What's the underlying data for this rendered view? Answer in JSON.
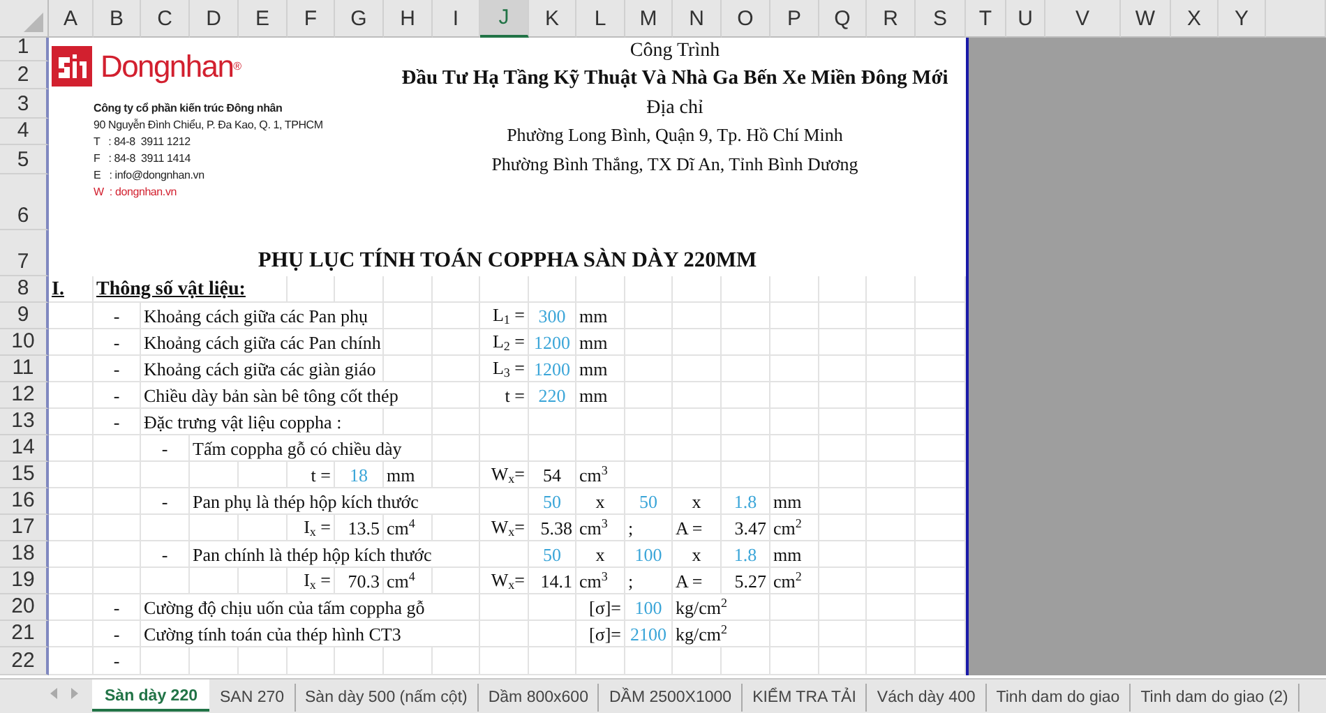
{
  "columns": [
    {
      "label": "A",
      "selected": false
    },
    {
      "label": "B",
      "selected": false
    },
    {
      "label": "C",
      "selected": false
    },
    {
      "label": "D",
      "selected": false
    },
    {
      "label": "E",
      "selected": false
    },
    {
      "label": "F",
      "selected": false
    },
    {
      "label": "G",
      "selected": false
    },
    {
      "label": "H",
      "selected": false
    },
    {
      "label": "I",
      "selected": false
    },
    {
      "label": "J",
      "selected": true
    },
    {
      "label": "K",
      "selected": false
    },
    {
      "label": "L",
      "selected": false
    },
    {
      "label": "M",
      "selected": false
    },
    {
      "label": "N",
      "selected": false
    },
    {
      "label": "O",
      "selected": false
    },
    {
      "label": "P",
      "selected": false
    },
    {
      "label": "Q",
      "selected": false
    },
    {
      "label": "R",
      "selected": false
    },
    {
      "label": "S",
      "selected": false
    },
    {
      "label": "T",
      "selected": false
    },
    {
      "label": "U",
      "selected": false
    },
    {
      "label": "V",
      "selected": false
    },
    {
      "label": "W",
      "selected": false
    },
    {
      "label": "X",
      "selected": false
    },
    {
      "label": "Y",
      "selected": false
    }
  ],
  "logo": {
    "brand": "Dongnhan$^{®}$"
  },
  "company": {
    "lines": [
      {
        "kind": "name",
        "text": "Công ty cổ phần kiến trúc Đông nhân"
      },
      {
        "kind": "plain",
        "text": "90 Nguyễn Đình Chiểu, P. Đa Kao, Q. 1, TPHCM"
      },
      {
        "kind": "plain",
        "text": "T   : 84-8  3911 1212"
      },
      {
        "kind": "plain",
        "text": "F   : 84-8  3911 1414"
      },
      {
        "kind": "plain",
        "text": "E   : info@dongnhan.vn"
      },
      {
        "kind": "web",
        "text": "W  : dongnhan.vn"
      }
    ]
  },
  "rows": [
    {
      "number": "1",
      "cells": [
        {
          "kind": "title",
          "text": "Công Trình"
        }
      ]
    },
    {
      "number": "2",
      "cells": [
        {
          "kind": "title-bold",
          "text": "Đầu Tư Hạ Tầng Kỹ Thuật Và Nhà Ga Bến Xe Miền Đông Mới"
        }
      ]
    },
    {
      "number": "3",
      "cells": [
        {
          "kind": "title",
          "text": "Địa chỉ"
        }
      ]
    },
    {
      "number": "4",
      "cells": [
        {
          "kind": "title-small",
          "text": "Phường Long Bình, Quận 9, Tp. Hồ Chí Minh"
        }
      ]
    },
    {
      "number": "5",
      "cells": [
        {
          "kind": "title-small",
          "text": "Phường Bình Thắng, TX Dĩ An, Tỉnh Bình Dương"
        }
      ]
    },
    {
      "number": "6",
      "cells": []
    },
    {
      "number": "7",
      "cells": [
        {
          "kind": "doc-title",
          "text": "PHỤ LỤC TÍNH TOÁN COPPHA SÀN DÀY 220MM"
        }
      ]
    },
    {
      "number": "8",
      "cells": [
        {
          "kind": "heading",
          "text": "I."
        },
        {
          "kind": "heading",
          "text": "Thông số vật liệu:"
        }
      ]
    },
    {
      "number": "9",
      "cells": [
        {
          "kind": "dash",
          "text": "-"
        },
        {
          "kind": "text",
          "text": "Khoảng cách giữa các Pan phụ"
        },
        {
          "kind": "label",
          "text": "L$_{1}$ ="
        },
        {
          "kind": "input",
          "text": "300"
        },
        {
          "kind": "unit",
          "text": "mm"
        }
      ]
    },
    {
      "number": "10",
      "cells": [
        {
          "kind": "dash",
          "text": "-"
        },
        {
          "kind": "text",
          "text": "Khoảng cách giữa các Pan chính"
        },
        {
          "kind": "label",
          "text": "L$_{2}$ ="
        },
        {
          "kind": "input",
          "text": "1200"
        },
        {
          "kind": "unit",
          "text": "mm"
        }
      ]
    },
    {
      "number": "11",
      "cells": [
        {
          "kind": "dash",
          "text": "-"
        },
        {
          "kind": "text",
          "text": "Khoảng cách giữa các giàn giáo"
        },
        {
          "kind": "label",
          "text": "L$_{3}$ ="
        },
        {
          "kind": "input",
          "text": "1200"
        },
        {
          "kind": "unit",
          "text": "mm"
        }
      ]
    },
    {
      "number": "12",
      "cells": [
        {
          "kind": "dash",
          "text": "-"
        },
        {
          "kind": "text",
          "text": "Chiều dày bản sàn bê tông cốt thép"
        },
        {
          "kind": "label",
          "text": "t ="
        },
        {
          "kind": "input",
          "text": "220"
        },
        {
          "kind": "unit",
          "text": "mm"
        }
      ]
    },
    {
      "number": "13",
      "cells": [
        {
          "kind": "dash",
          "text": "-"
        },
        {
          "kind": "text",
          "text": "Đặc trưng vật liệu coppha :"
        }
      ]
    },
    {
      "number": "14",
      "cells": [
        {
          "kind": "dash",
          "text": "-"
        },
        {
          "kind": "text",
          "text": "Tấm coppha gỗ có chiều dày"
        }
      ]
    },
    {
      "number": "15",
      "cells": [
        {
          "kind": "label",
          "text": "t ="
        },
        {
          "kind": "input",
          "text": "18"
        },
        {
          "kind": "unit",
          "text": "mm"
        },
        {
          "kind": "label",
          "text": "W$_{x}$="
        },
        {
          "kind": "value",
          "text": "54"
        },
        {
          "kind": "unit",
          "text": "cm$^{3}$"
        }
      ]
    },
    {
      "number": "16",
      "cells": [
        {
          "kind": "dash",
          "text": "-"
        },
        {
          "kind": "text",
          "text": "Pan phụ là thép hộp kích thước"
        },
        {
          "kind": "input",
          "text": "50"
        },
        {
          "kind": "dash",
          "text": "x"
        },
        {
          "kind": "input",
          "text": "50"
        },
        {
          "kind": "dash",
          "text": "x"
        },
        {
          "kind": "input",
          "text": "1.8"
        },
        {
          "kind": "unit",
          "text": "mm"
        }
      ]
    },
    {
      "number": "17",
      "cells": [
        {
          "kind": "label",
          "text": "I$_{x}$ ="
        },
        {
          "kind": "number",
          "text": "13.5"
        },
        {
          "kind": "unit",
          "text": "cm$^{4}$"
        },
        {
          "kind": "label",
          "text": "W$_{x}$="
        },
        {
          "kind": "number",
          "text": "5.38"
        },
        {
          "kind": "unit",
          "text": "cm$^{3}$"
        },
        {
          "kind": "unit",
          "text": ";"
        },
        {
          "kind": "unit",
          "text": "A ="
        },
        {
          "kind": "number",
          "text": "3.47"
        },
        {
          "kind": "unit",
          "text": "cm$^{2}$"
        }
      ]
    },
    {
      "number": "18",
      "cells": [
        {
          "kind": "dash",
          "text": "-"
        },
        {
          "kind": "text",
          "text": "Pan chính là thép hộp kích thước"
        },
        {
          "kind": "input",
          "text": "50"
        },
        {
          "kind": "dash",
          "text": "x"
        },
        {
          "kind": "input",
          "text": "100"
        },
        {
          "kind": "dash",
          "text": "x"
        },
        {
          "kind": "input",
          "text": "1.8"
        },
        {
          "kind": "unit",
          "text": "mm"
        }
      ]
    },
    {
      "number": "19",
      "cells": [
        {
          "kind": "label",
          "text": "I$_{x}$ ="
        },
        {
          "kind": "number",
          "text": "70.3"
        },
        {
          "kind": "unit",
          "text": "cm$^{4}$"
        },
        {
          "kind": "label",
          "text": "W$_{x}$="
        },
        {
          "kind": "number",
          "text": "14.1"
        },
        {
          "kind": "unit",
          "text": "cm$^{3}$"
        },
        {
          "kind": "unit",
          "text": ";"
        },
        {
          "kind": "unit",
          "text": "A ="
        },
        {
          "kind": "number",
          "text": "5.27"
        },
        {
          "kind": "unit",
          "text": "cm$^{2}$"
        }
      ]
    },
    {
      "number": "20",
      "cells": [
        {
          "kind": "dash",
          "text": "-"
        },
        {
          "kind": "text",
          "text": "Cường độ chịu uốn của tấm coppha gỗ"
        },
        {
          "kind": "label",
          "text": "[σ]="
        },
        {
          "kind": "input",
          "text": "100"
        },
        {
          "kind": "unit",
          "text": "kg/cm$^{2}$"
        }
      ]
    },
    {
      "number": "21",
      "cells": [
        {
          "kind": "dash",
          "text": "-"
        },
        {
          "kind": "text",
          "text": "Cường tính toán của thép hình CT3"
        },
        {
          "kind": "label",
          "text": "[σ]="
        },
        {
          "kind": "input",
          "text": "2100"
        },
        {
          "kind": "unit",
          "text": "kg/cm$^{2}$"
        }
      ]
    },
    {
      "number": "22",
      "cells": [
        {
          "kind": "dash",
          "text": "-"
        }
      ]
    }
  ],
  "sheet_tabs": [
    {
      "label": "Sàn dày 220",
      "selected": true
    },
    {
      "label": "SAN 270",
      "selected": false
    },
    {
      "label": "Sàn dày 500 (nấm cột)",
      "selected": false
    },
    {
      "label": "Dầm 800x600",
      "selected": false
    },
    {
      "label": "DẦM 2500X1000",
      "selected": false
    },
    {
      "label": "KIỂM TRA TẢI",
      "selected": false
    },
    {
      "label": "Vách dày 400",
      "selected": false
    },
    {
      "label": "Tinh dam do giao",
      "selected": false
    },
    {
      "label": "Tinh dam do giao (2)",
      "selected": false
    }
  ]
}
